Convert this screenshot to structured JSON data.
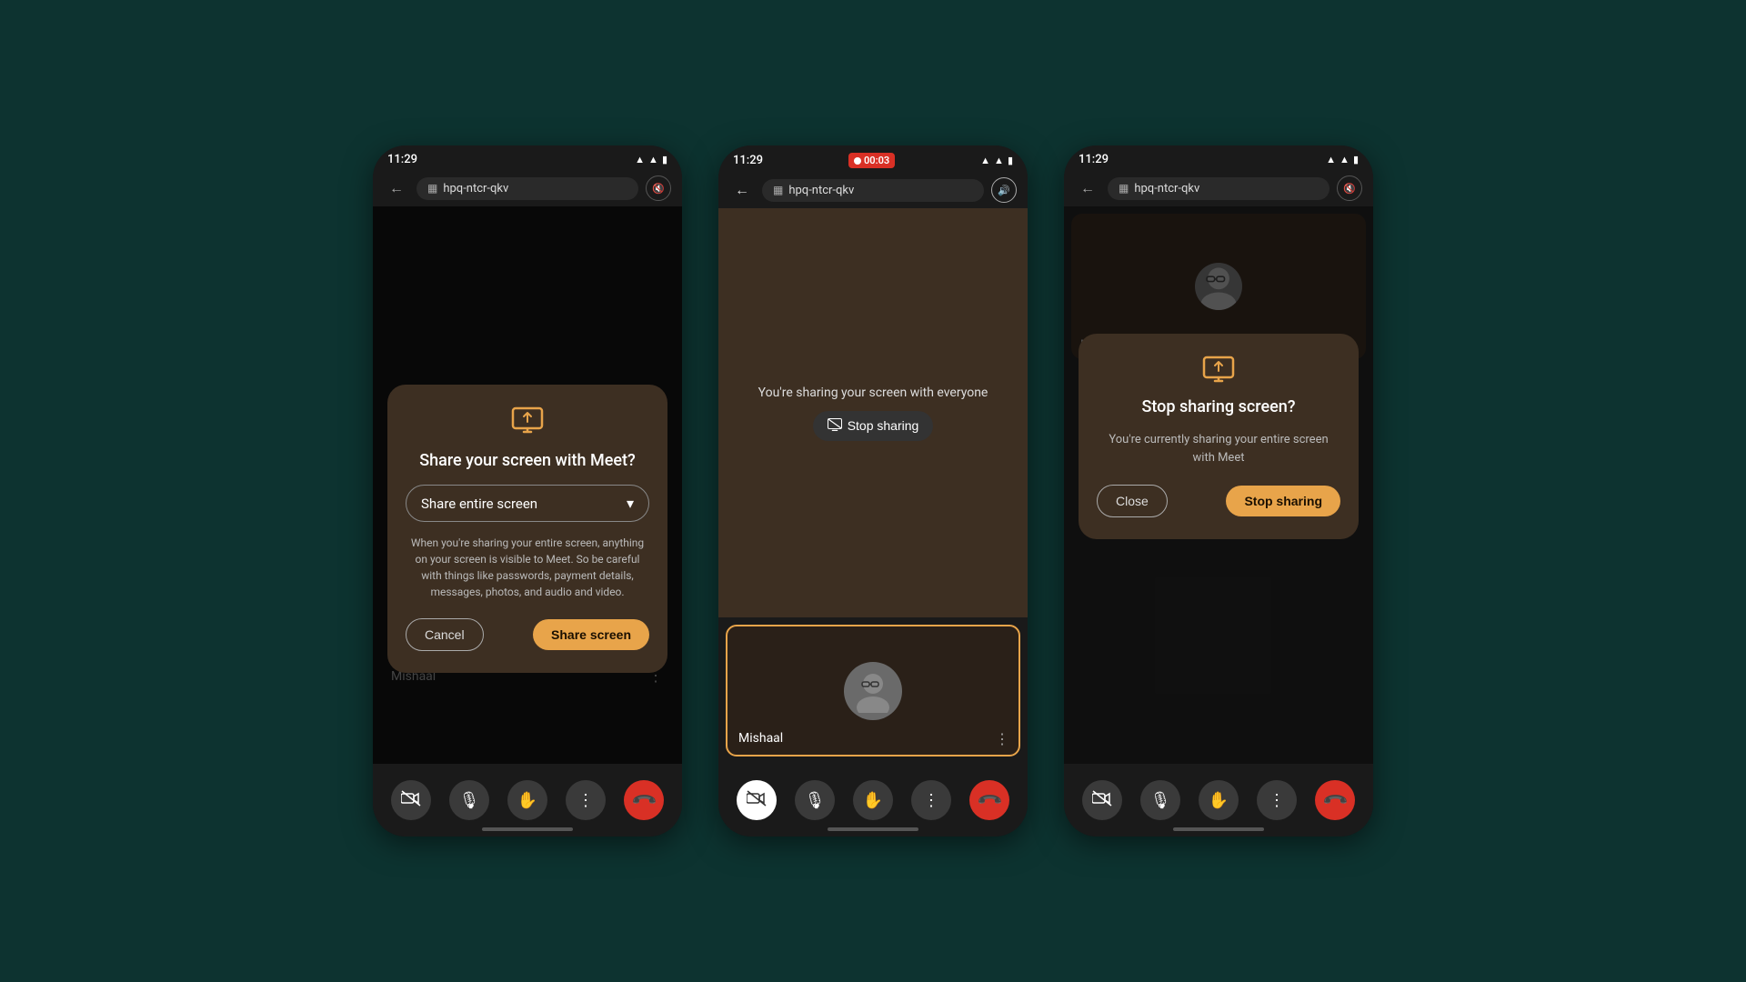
{
  "background_color": "#0d3330",
  "phone1": {
    "status_time": "11:29",
    "url": "hpq-ntcr-qkv",
    "modal": {
      "title": "Share your screen with Meet?",
      "dropdown_label": "Share entire screen",
      "warning_text": "When you're sharing your entire screen, anything on your screen is visible to Meet. So be careful with things like passwords, payment details, messages, photos, and audio and video.",
      "cancel_label": "Cancel",
      "share_label": "Share screen"
    },
    "participant_name": "Mishaal"
  },
  "phone2": {
    "status_time": "11:29",
    "recording_label": "00:03",
    "url": "hpq-ntcr-qkv",
    "sharing_text": "You're sharing your screen with everyone",
    "stop_sharing_label": "Stop sharing",
    "participant_name": "Mishaal"
  },
  "phone3": {
    "status_time": "11:29",
    "url": "hpq-ntcr-qkv",
    "modal": {
      "title": "Stop sharing screen?",
      "subtitle": "You're currently sharing your entire screen with Meet",
      "close_label": "Close",
      "stop_label": "Stop sharing"
    },
    "participant_name": "Mishaal"
  },
  "icons": {
    "back": "←",
    "calendar": "📅",
    "sound_off": "🔇",
    "sound_on": "🔊",
    "camera_off": "📷",
    "mic": "🎙",
    "hand": "✋",
    "more": "⋮",
    "end_call": "📞",
    "chevron_down": "▾",
    "stop_share_icon": "⊡",
    "wifi": "▲",
    "signal": "▲",
    "battery": "▮"
  }
}
